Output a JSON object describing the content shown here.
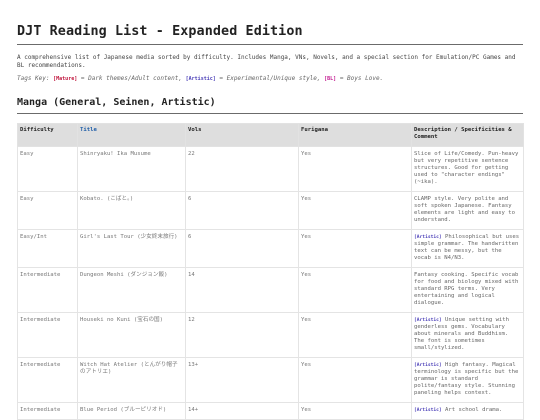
{
  "page": {
    "title": "DJT Reading List - Expanded Edition",
    "intro": "A comprehensive list of Japanese media sorted by difficulty. Includes Manga, VNs, Novels, and a special section for Emulation/PC Games and BL recommendations.",
    "tag_key": {
      "prefix": "Tags Key:",
      "mature_tag": "[Mature]",
      "mature_text": "= Dark themes/Adult content,",
      "artistic_tag": "[Artistic]",
      "artistic_text": "= Experimental/Unique style,",
      "bl_tag": "[BL]",
      "bl_text": "= Boys Love."
    }
  },
  "manga": {
    "heading": "Manga (General, Seinen, Artistic)",
    "columns": {
      "difficulty": "Difficulty",
      "title": "Title",
      "vols": "Vols",
      "furigana": "Furigana",
      "description": "Description / Specificities & Comment"
    },
    "rows": [
      {
        "difficulty": "Easy",
        "title": "Shinryaku! Ika Musume",
        "vols": "22",
        "furigana": "Yes",
        "tag": "",
        "desc": "Slice of Life/Comedy. Pun-heavy but very repetitive sentence structures. Good for getting used to \"character endings\" (~ika)."
      },
      {
        "difficulty": "Easy",
        "title": "Kobato. (こばと。)",
        "vols": "6",
        "furigana": "Yes",
        "tag": "",
        "desc": "CLAMP style. Very polite and soft spoken Japanese. Fantasy elements are light and easy to understand."
      },
      {
        "difficulty": "Easy/Int",
        "title": "Girl's Last Tour (少女終末旅行)",
        "vols": "6",
        "furigana": "Yes",
        "tag": "[Artistic]",
        "desc": "Philosophical but uses simple grammar. The handwritten text can be messy, but the vocab is N4/N3."
      },
      {
        "difficulty": "Intermediate",
        "title": "Dungeon Meshi (ダンジョン飯)",
        "vols": "14",
        "furigana": "Yes",
        "tag": "",
        "desc": "Fantasy cooking. Specific vocab for food and biology mixed with standard RPG terms. Very entertaining and logical dialogue."
      },
      {
        "difficulty": "Intermediate",
        "title": "Houseki no Kuni (宝石の国)",
        "vols": "12",
        "furigana": "Yes",
        "tag": "[Artistic]",
        "desc": "Unique setting with genderless gems. Vocabulary about minerals and Buddhism. The font is sometimes small/stylized."
      },
      {
        "difficulty": "Intermediate",
        "title": "Witch Hat Atelier (とんがり帽子のアトリエ)",
        "vols": "13+",
        "furigana": "Yes",
        "tag": "[Artistic]",
        "desc": "High fantasy. Magical terminology is specific but the grammar is standard polite/fantasy style. Stunning paneling helps context."
      },
      {
        "difficulty": "Intermediate",
        "title": "Blue Period (ブルーピリオド)",
        "vols": "14+",
        "furigana": "Yes",
        "tag": "[Artistic]",
        "desc": "Art school drama."
      }
    ]
  }
}
